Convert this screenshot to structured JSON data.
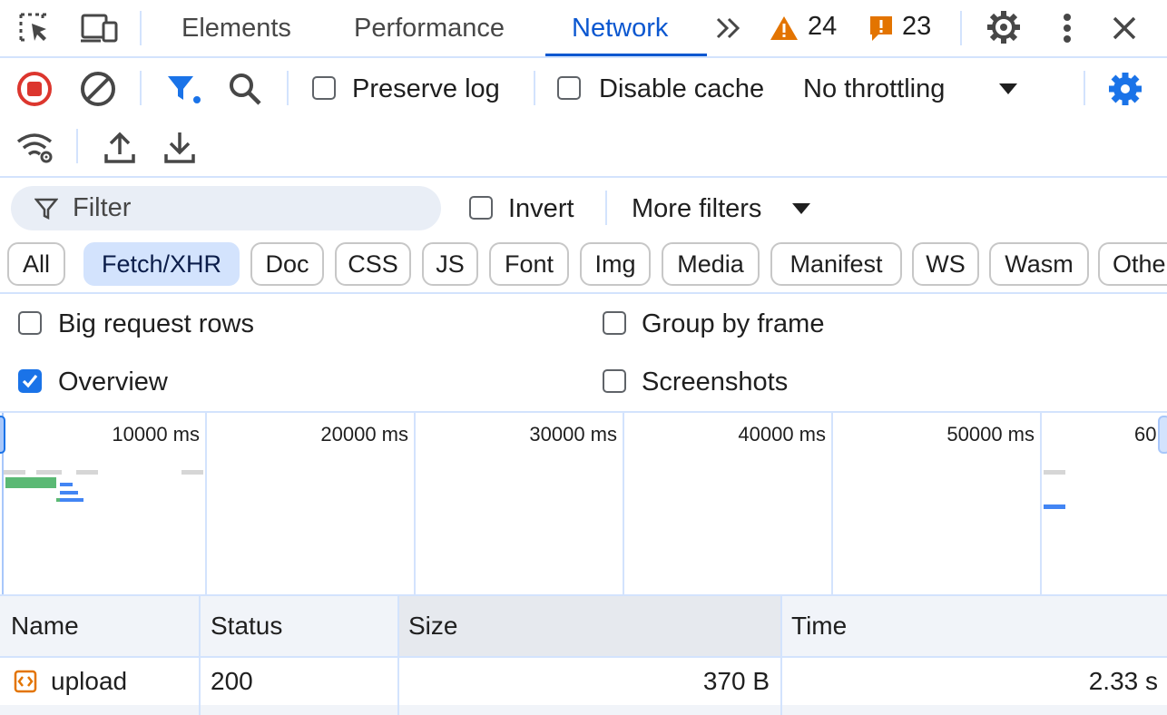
{
  "tabs": [
    {
      "label": "Elements"
    },
    {
      "label": "Performance"
    },
    {
      "label": "Network"
    }
  ],
  "badges": {
    "warnings": "24",
    "issues": "23"
  },
  "toolbar": {
    "preserve_log_label": "Preserve log",
    "disable_cache_label": "Disable cache",
    "throttling_value": "No throttling"
  },
  "filter": {
    "placeholder": "Filter",
    "invert_label": "Invert",
    "more_filters_label": "More filters"
  },
  "type_filters": [
    "All",
    "Fetch/XHR",
    "Doc",
    "CSS",
    "JS",
    "Font",
    "Img",
    "Media",
    "Manifest",
    "WS",
    "Wasm",
    "Othe"
  ],
  "settings": {
    "big_request_rows_label": "Big request rows",
    "group_by_frame_label": "Group by frame",
    "overview_label": "Overview",
    "screenshots_label": "Screenshots",
    "overview_checked": true
  },
  "overview": {
    "ticks": [
      "10000 ms",
      "20000 ms",
      "30000 ms",
      "40000 ms",
      "50000 ms",
      "60"
    ]
  },
  "table": {
    "columns": [
      "Name",
      "Status",
      "Size",
      "Time"
    ],
    "rows": [
      {
        "name": "upload",
        "status": "200",
        "size": "370 B",
        "time": "2.33 s"
      }
    ]
  },
  "colors": {
    "accent": "#0b57d0",
    "record": "#dc362e",
    "warning": "#e37400",
    "border": "#d3e3fd"
  }
}
